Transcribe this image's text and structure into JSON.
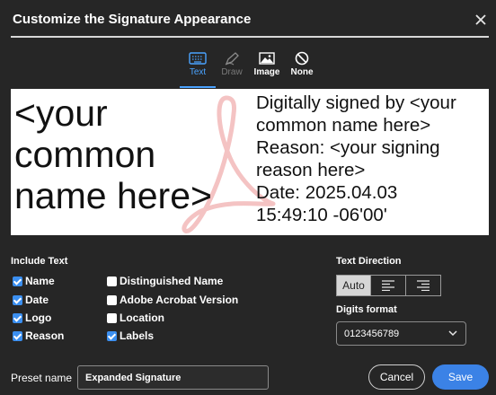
{
  "dialog": {
    "title": "Customize the Signature Appearance",
    "close_icon": "close-icon"
  },
  "tabs": [
    {
      "label": "Text",
      "icon": "keyboard-icon",
      "state": "active"
    },
    {
      "label": "Draw",
      "icon": "pen-icon",
      "state": "disabled"
    },
    {
      "label": "Image",
      "icon": "image-icon",
      "state": "normal"
    },
    {
      "label": "None",
      "icon": "none-icon",
      "state": "normal"
    }
  ],
  "preview": {
    "name_lines": [
      "<your",
      "common",
      "name here>"
    ],
    "details_lines": [
      "Digitally signed by <your",
      "common name here>",
      "Reason: <your signing",
      "reason here>",
      "Date: 2025.04.03",
      "15:49:10 -06'00'"
    ]
  },
  "include_text": {
    "title": "Include Text",
    "col1": [
      {
        "label": "Name",
        "checked": true
      },
      {
        "label": "Date",
        "checked": true
      },
      {
        "label": "Logo",
        "checked": true
      },
      {
        "label": "Reason",
        "checked": true
      }
    ],
    "col2": [
      {
        "label": "Distinguished Name",
        "checked": false
      },
      {
        "label": "Adobe Acrobat Version",
        "checked": false
      },
      {
        "label": "Location",
        "checked": false
      },
      {
        "label": "Labels",
        "checked": true
      }
    ]
  },
  "text_direction": {
    "title": "Text Direction",
    "auto_label": "Auto",
    "selected": "Auto"
  },
  "digits_format": {
    "title": "Digits format",
    "value": "0123456789"
  },
  "preset": {
    "label": "Preset name",
    "value": "Expanded Signature"
  },
  "buttons": {
    "cancel": "Cancel",
    "save": "Save"
  },
  "colors": {
    "accent": "#3b82e6",
    "tab_active": "#4aa3ff",
    "background": "#262626",
    "logo": "#f2b8b8"
  }
}
